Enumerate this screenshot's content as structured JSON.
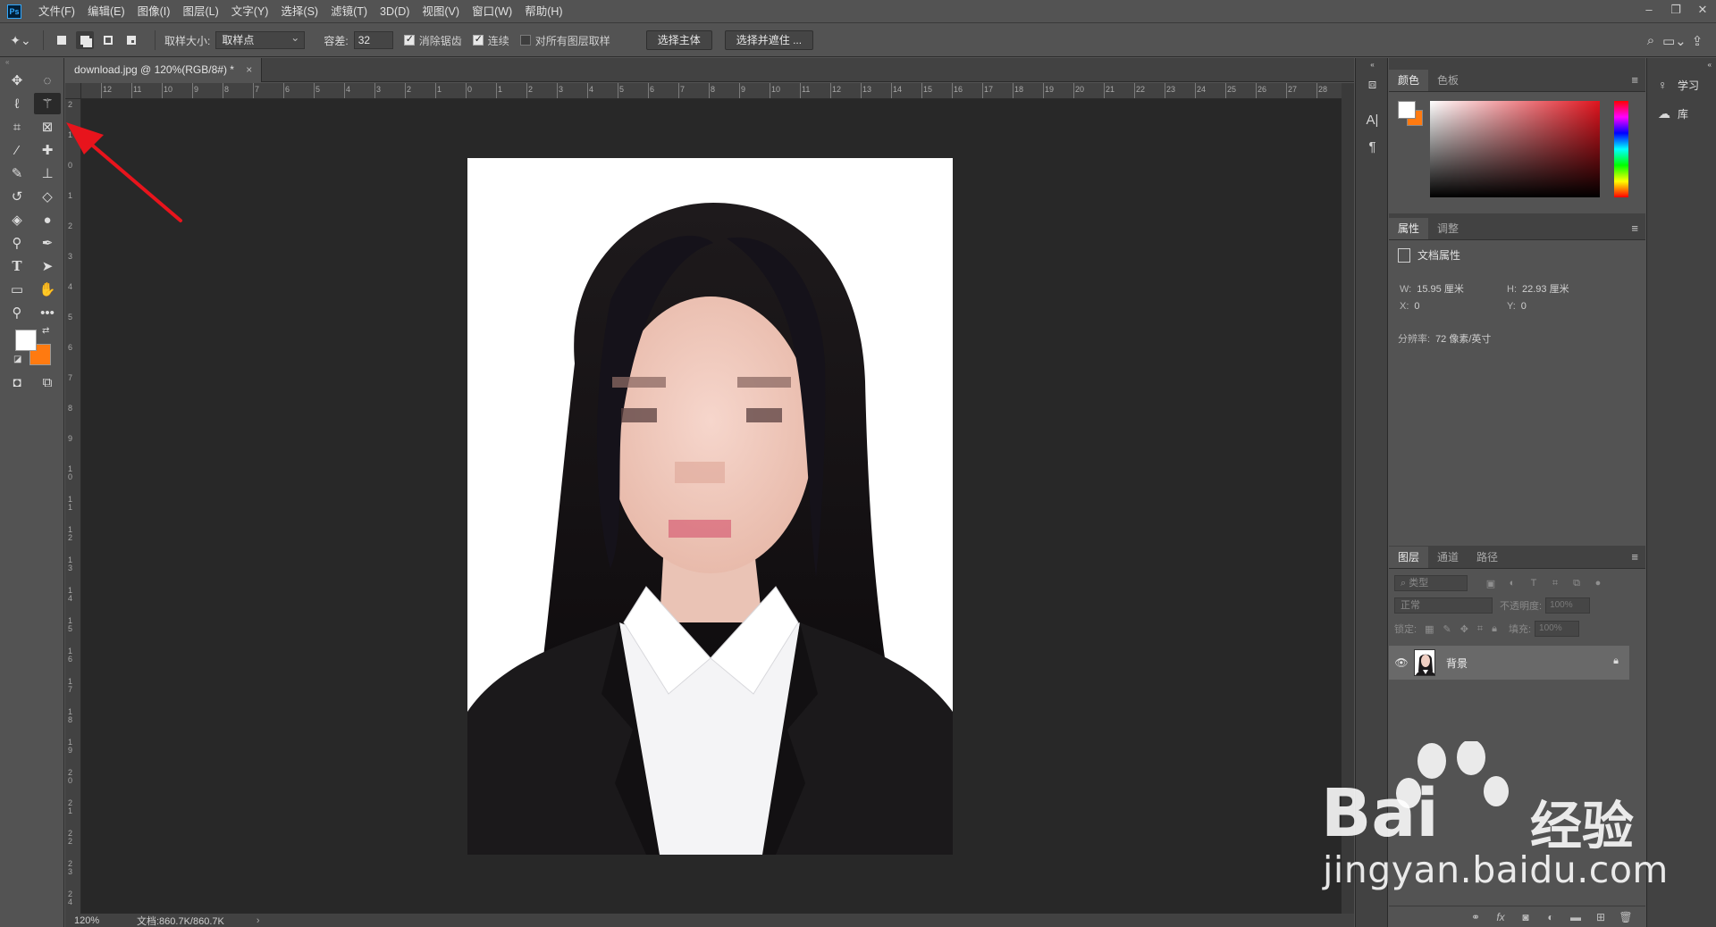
{
  "app": {
    "logo": "Ps",
    "menu": [
      "文件(F)",
      "编辑(E)",
      "图像(I)",
      "图层(L)",
      "文字(Y)",
      "选择(S)",
      "滤镜(T)",
      "3D(D)",
      "视图(V)",
      "窗口(W)",
      "帮助(H)"
    ],
    "window_controls": {
      "minimize": "–",
      "restore": "❐",
      "close": "✕"
    }
  },
  "options": {
    "sample_size_label": "取样大小:",
    "sample_size_value": "取样点",
    "tolerance_label": "容差:",
    "tolerance_value": "32",
    "antialias_label": "消除锯齿",
    "antialias_checked": true,
    "contiguous_label": "连续",
    "contiguous_checked": true,
    "sample_all_label": "对所有图层取样",
    "sample_all_checked": false,
    "select_subject_label": "选择主体",
    "select_mask_label": "选择并遮住 ..."
  },
  "document": {
    "tab_title": "download.jpg @ 120%(RGB/8#) *",
    "close": "×",
    "ruler_top_labels": [
      "12",
      "11",
      "10",
      "9",
      "8",
      "7",
      "6",
      "5",
      "4",
      "3",
      "2",
      "1",
      "0",
      "1",
      "2",
      "3",
      "4",
      "5",
      "6",
      "7",
      "8",
      "9",
      "10",
      "11",
      "12",
      "13",
      "14",
      "15",
      "16",
      "17",
      "18",
      "19",
      "20",
      "21",
      "22",
      "23",
      "24",
      "25",
      "26",
      "27",
      "28"
    ],
    "ruler_left_labels": [
      "2",
      "1",
      "0",
      "1",
      "2",
      "3",
      "4",
      "5",
      "6",
      "7",
      "8",
      "9",
      "10",
      "11",
      "12",
      "13",
      "14",
      "15",
      "16",
      "17",
      "18",
      "19",
      "20",
      "21",
      "22",
      "23",
      "24"
    ],
    "status_zoom": "120%",
    "status_doc": "文档:860.7K/860.7K",
    "status_arrow": "›"
  },
  "color_panel": {
    "tabs": [
      "颜色",
      "色板"
    ],
    "active_tab": "颜色",
    "foreground": "#ffffff",
    "background": "#ff7a10"
  },
  "properties_panel": {
    "tabs": [
      "属性",
      "调整"
    ],
    "active_tab": "属性",
    "header": "文档属性",
    "w_label": "W:",
    "w_value": "15.95 厘米",
    "h_label": "H:",
    "h_value": "22.93 厘米",
    "x_label": "X:",
    "x_value": "0",
    "y_label": "Y:",
    "y_value": "0",
    "resolution_label": "分辨率:",
    "resolution_value": "72 像素/英寸"
  },
  "layers_panel": {
    "tabs": [
      "图层",
      "通道",
      "路径"
    ],
    "active_tab": "图层",
    "filter_placeholder": "类型",
    "blend_mode": "正常",
    "opacity_label": "不透明度:",
    "opacity_value": "100%",
    "lock_label": "锁定:",
    "fill_label": "填充:",
    "fill_value": "100%",
    "layers": [
      {
        "name": "背景",
        "visible": true,
        "locked": true
      }
    ]
  },
  "learn_panel": {
    "items": [
      {
        "label": "学习",
        "icon": "lightbulb-icon"
      },
      {
        "label": "库",
        "icon": "cloud-library-icon"
      }
    ]
  },
  "watermark": {
    "brand": "Bai",
    "brand_cn": "经验",
    "domain": "jingyan.baidu.com"
  }
}
